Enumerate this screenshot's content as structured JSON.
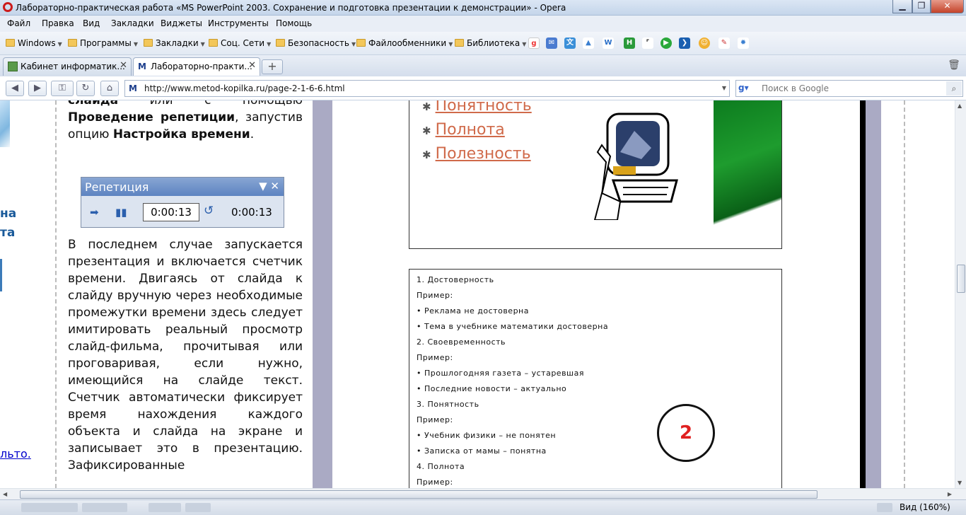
{
  "window": {
    "title": "Лабораторно-практическая работа «MS PowerPoint 2003. Сохранение и подготовка презентации к демонстрации» - Opera",
    "min_glyph": "▁",
    "max_glyph": "❐",
    "close_glyph": "✕"
  },
  "menu": {
    "items": [
      "Файл",
      "Правка",
      "Вид",
      "Закладки",
      "Виджеты",
      "Инструменты",
      "Помощь"
    ]
  },
  "bookmarks": {
    "folders": [
      "Windows",
      "Программы",
      "Закладки",
      "Соц. Сети",
      "Безопасность",
      "Файлообменники",
      "Библиотека"
    ],
    "quick_icons": [
      "google-icon",
      "mail-icon",
      "translate-icon",
      "wiki-icon",
      "w-icon",
      "h-icon",
      "fullscreen-icon",
      "play-icon",
      "arrow-icon",
      "smile-icon",
      "tool-icon",
      "gear-icon"
    ]
  },
  "tabs": [
    {
      "label": "Кабинет информатик...",
      "active": false
    },
    {
      "label": "Лабораторно-практи...",
      "active": true
    }
  ],
  "address": {
    "url": "http://www.metod-kopilka.ru/page-2-1-6-6.html",
    "site_icon": "M",
    "search_placeholder": "Поиск в Google"
  },
  "left_column": {
    "fragments": [
      "на",
      "та"
    ],
    "link_fragment": "льто"
  },
  "article": {
    "intro_html_parts": [
      {
        "text": "слайда",
        "bold": true
      },
      {
        "text": " или с помощью ",
        "bold": false
      },
      {
        "text": "Проведение репетиции",
        "bold": true
      },
      {
        "text": ", запустив опцию ",
        "bold": false
      },
      {
        "text": "Настройка времени",
        "bold": true
      },
      {
        "text": ".",
        "bold": false
      }
    ],
    "body": "В последнем случае запускается презентация и включается счетчик времени. Двигаясь от слайда к слайду вручную через необходимые промежутки времени здесь следует имитировать реальный просмотр слайд-фильма, прочитывая или проговаривая, если нужно, имеющийся на слайде текст. Счетчик автоматически фиксирует время нахождения каждого объекта и слайда на экране и записывает это в презентацию. Зафиксированные"
  },
  "rehearsal_toolbar": {
    "title": "Репетиция",
    "slide_time": "0:00:13",
    "total_time": "0:00:13"
  },
  "slide1": {
    "bullets": [
      "Понятность",
      "Полнота",
      "Полезность"
    ]
  },
  "slide2": {
    "lines": [
      "1.   Достоверность",
      "Пример:",
      "•     Реклама не достоверна",
      "•     Тема в учебнике математики достоверна",
      "2. Своевременность",
      "Пример:",
      "•     Прошлогодняя газета – устаревшая",
      "•     Последние новости – актуально",
      "3. Понятность",
      "Пример:",
      "•     Учебник физики – не понятен",
      "•     Записка от мамы – понятна",
      "4. Полнота",
      "Пример:"
    ],
    "badge": "2"
  },
  "status": {
    "zoom": "Вид (160%)"
  },
  "colors": {
    "opera_red": "#cc1b1b",
    "toolbar_blue": "#5d83c1",
    "slide_link": "#d06a4a",
    "badge_number": "#e02020",
    "side_gray": "#aaaac4"
  }
}
